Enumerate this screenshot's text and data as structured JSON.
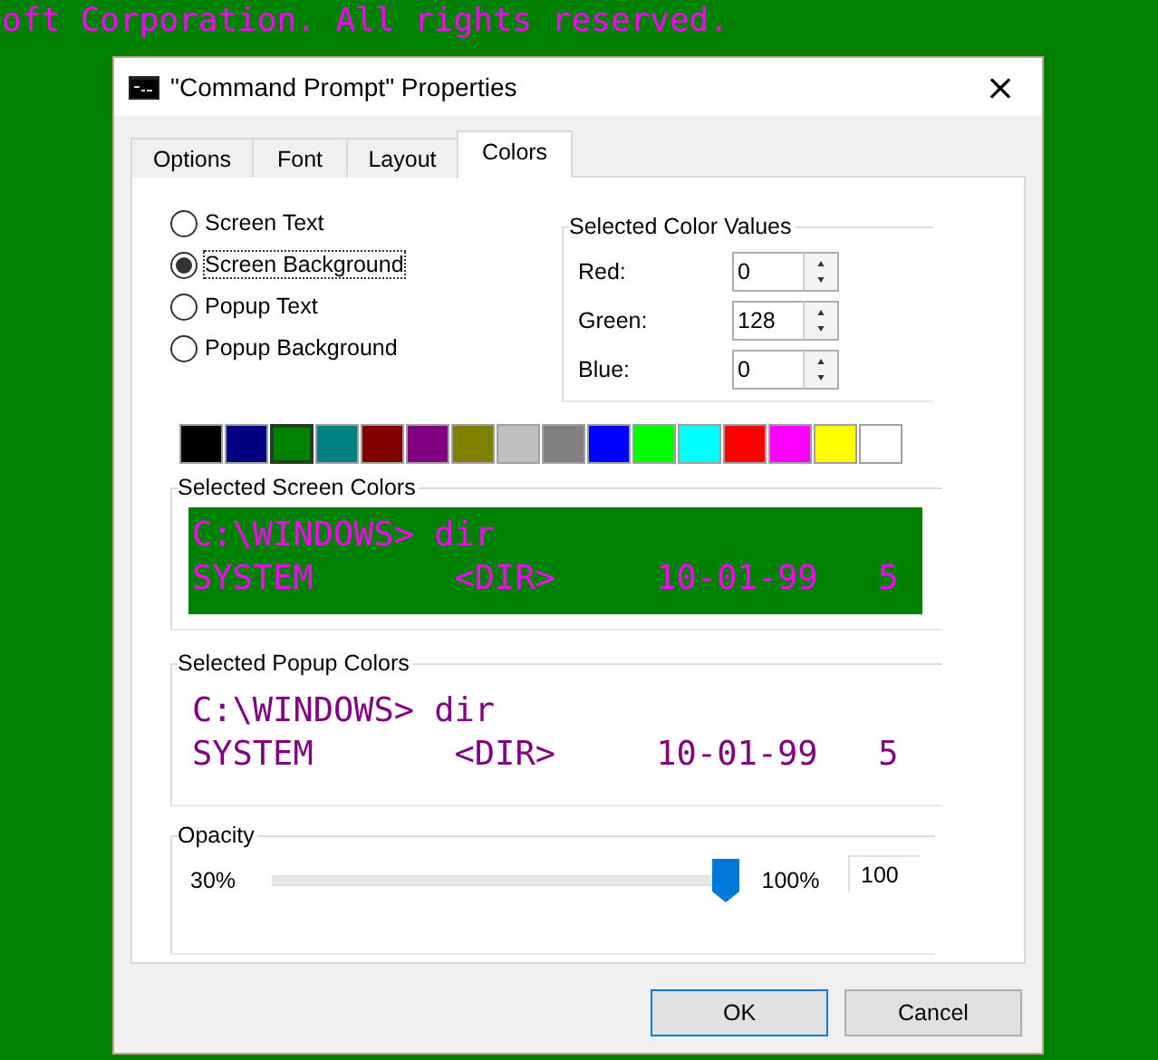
{
  "console_text": "oft Corporation. All rights reserved.",
  "window": {
    "title": "\"Command Prompt\" Properties",
    "close": "×"
  },
  "tabs": [
    {
      "label": "Options",
      "selected": false
    },
    {
      "label": "Font",
      "selected": false
    },
    {
      "label": "Layout",
      "selected": false
    },
    {
      "label": "Colors",
      "selected": true
    }
  ],
  "color_targets": [
    {
      "label": "Screen Text",
      "selected": false
    },
    {
      "label": "Screen Background",
      "selected": true
    },
    {
      "label": "Popup Text",
      "selected": false
    },
    {
      "label": "Popup Background",
      "selected": false
    }
  ],
  "color_values": {
    "title": "Selected Color Values",
    "fields": [
      {
        "label": "Red:",
        "value": "0"
      },
      {
        "label": "Green:",
        "value": "128"
      },
      {
        "label": "Blue:",
        "value": "0"
      }
    ]
  },
  "palette": [
    {
      "color": "#000000",
      "selected": false
    },
    {
      "color": "#000080",
      "selected": false
    },
    {
      "color": "#008000",
      "selected": true
    },
    {
      "color": "#008080",
      "selected": false
    },
    {
      "color": "#800000",
      "selected": false
    },
    {
      "color": "#800080",
      "selected": false
    },
    {
      "color": "#808000",
      "selected": false
    },
    {
      "color": "#c0c0c0",
      "selected": false
    },
    {
      "color": "#808080",
      "selected": false
    },
    {
      "color": "#0000ff",
      "selected": false
    },
    {
      "color": "#00ff00",
      "selected": false
    },
    {
      "color": "#00ffff",
      "selected": false
    },
    {
      "color": "#ff0000",
      "selected": false
    },
    {
      "color": "#ff00ff",
      "selected": false
    },
    {
      "color": "#ffff00",
      "selected": false
    },
    {
      "color": "#ffffff",
      "selected": false
    }
  ],
  "screen_preview": {
    "title": "Selected Screen Colors",
    "lines": [
      [
        "C:\\WINDOWS> dir"
      ],
      [
        "SYSTEM",
        "<DIR>",
        "10-01-99",
        "5"
      ]
    ]
  },
  "popup_preview": {
    "title": "Selected Popup Colors",
    "lines": [
      [
        "C:\\WINDOWS> dir"
      ],
      [
        "SYSTEM",
        "<DIR>",
        "10-01-99",
        "5"
      ]
    ]
  },
  "opacity": {
    "title": "Opacity",
    "min_label": "30%",
    "max_label": "100%",
    "level": 1,
    "value": "100"
  },
  "buttons": [
    {
      "label": "OK",
      "kind": "default"
    },
    {
      "label": "Cancel",
      "kind": "normal"
    }
  ]
}
